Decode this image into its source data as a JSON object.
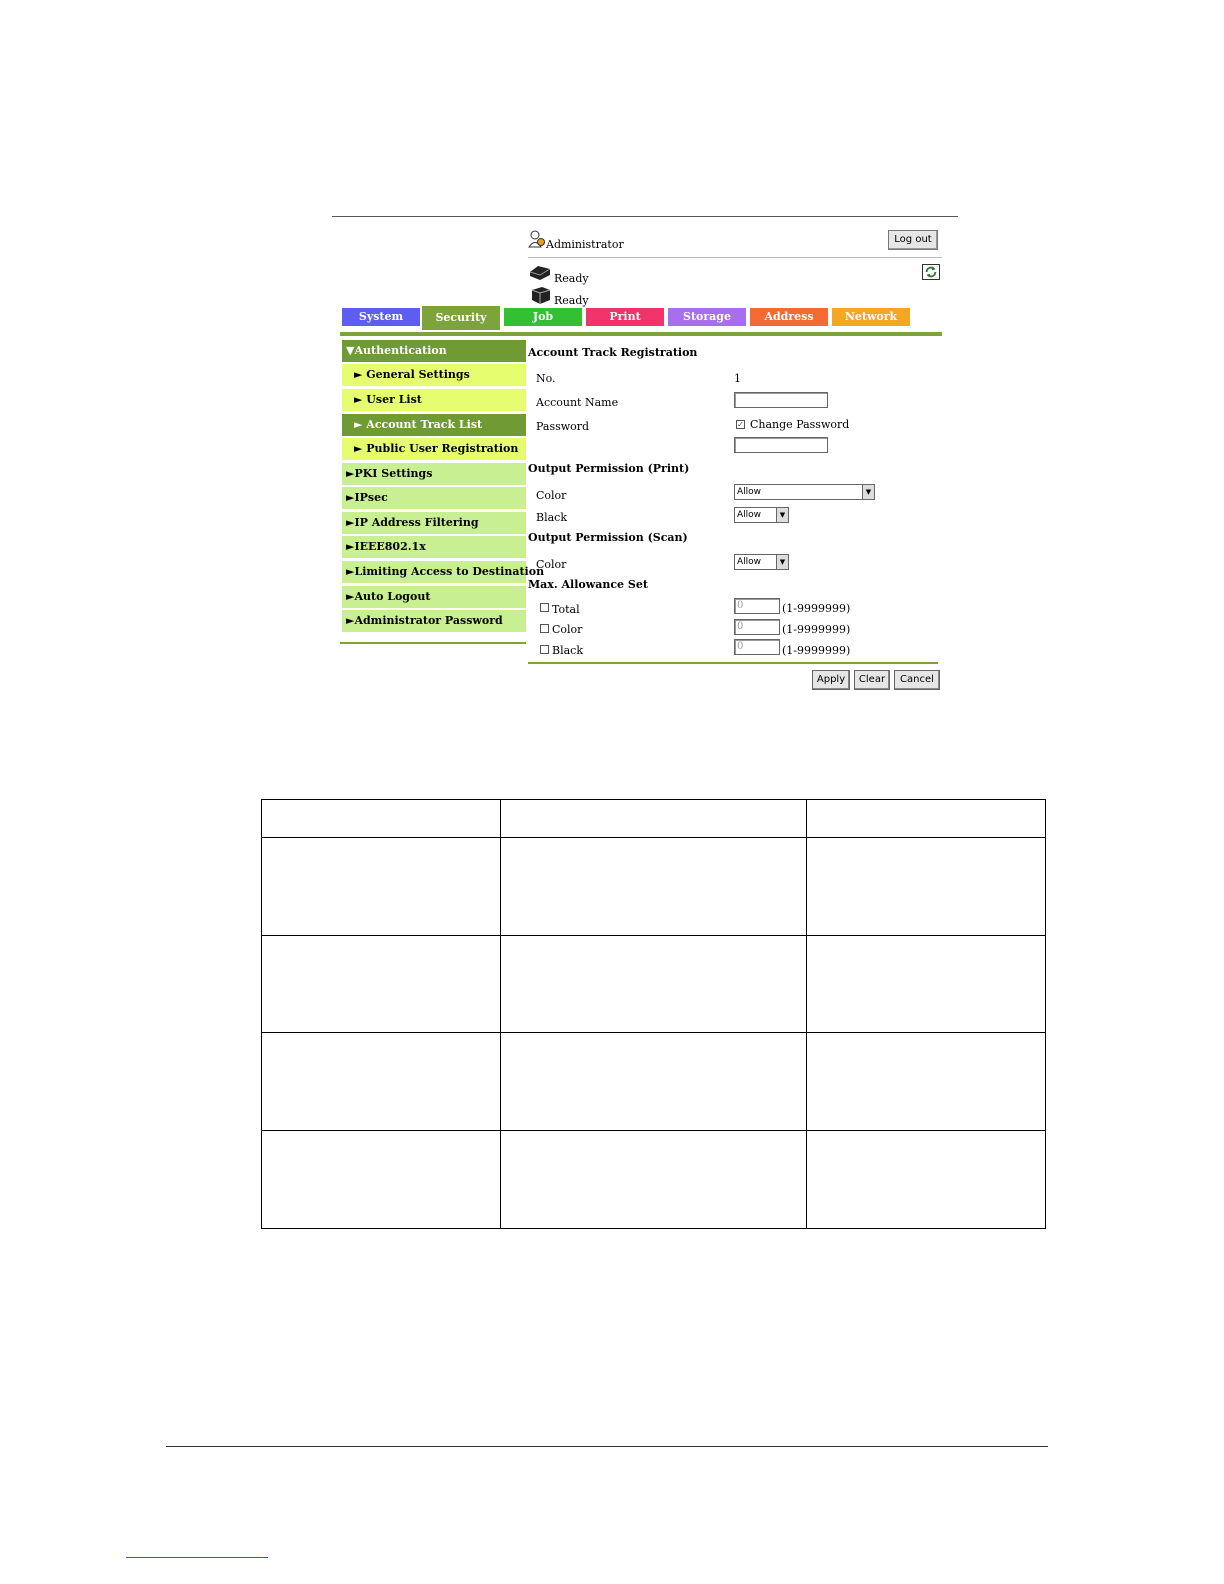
{
  "header": {
    "user_label": "Administrator",
    "logout_label": "Log out",
    "status_1": "Ready",
    "status_2": "Ready"
  },
  "tabs": [
    {
      "label": "System",
      "color": "#5d5df2"
    },
    {
      "label": "Security",
      "color": "#7ea33c",
      "active": true
    },
    {
      "label": "Job",
      "color": "#33c133"
    },
    {
      "label": "Print",
      "color": "#f0336a"
    },
    {
      "label": "Storage",
      "color": "#a86ef0"
    },
    {
      "label": "Address",
      "color": "#f56a33"
    },
    {
      "label": "Network",
      "color": "#f5a623"
    }
  ],
  "sidebar": {
    "items": [
      {
        "label": "▼Authentication",
        "level": 1,
        "state": "head"
      },
      {
        "label": "► General Settings",
        "level": 2
      },
      {
        "label": "► User List",
        "level": 2
      },
      {
        "label": "► Account Track List",
        "level": 2,
        "state": "selected"
      },
      {
        "label": "► Public User Registration",
        "level": 2
      },
      {
        "label": "►PKI Settings",
        "level": 1
      },
      {
        "label": "►IPsec",
        "level": 1
      },
      {
        "label": "►IP Address Filtering",
        "level": 1
      },
      {
        "label": "►IEEE802.1x",
        "level": 1
      },
      {
        "label": "►Limiting Access to Destination",
        "level": 1
      },
      {
        "label": "►Auto Logout",
        "level": 1
      },
      {
        "label": "►Administrator Password",
        "level": 1
      }
    ]
  },
  "form": {
    "title": "Account Track Registration",
    "no_label": "No.",
    "no_value": "1",
    "account_name_label": "Account Name",
    "account_name_value": "",
    "password_label": "Password",
    "change_password_label": "Change Password",
    "change_password_checked": true,
    "password_value": "",
    "print_section": "Output Permission (Print)",
    "print_color_label": "Color",
    "print_color_value": "Allow",
    "print_black_label": "Black",
    "print_black_value": "Allow",
    "scan_section": "Output Permission (Scan)",
    "scan_color_label": "Color",
    "scan_color_value": "Allow",
    "max_section": "Max. Allowance Set",
    "total_label": "Total",
    "total_value": "0",
    "total_range": "(1-9999999)",
    "color_label": "Color",
    "color_value": "0",
    "color_range": "(1-9999999)",
    "black_label": "Black",
    "black_value": "0",
    "black_range": "(1-9999999)",
    "apply_label": "Apply",
    "clear_label": "Clear",
    "cancel_label": "Cancel"
  }
}
